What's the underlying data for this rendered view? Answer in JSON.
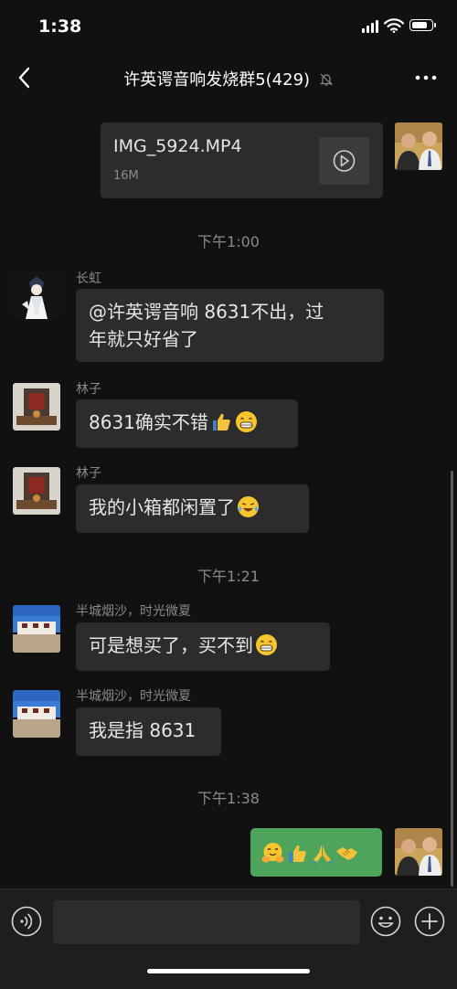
{
  "status_bar": {
    "time": "1:38"
  },
  "header": {
    "title": "许英谔音响发烧群5(429)",
    "muted": true
  },
  "file_message": {
    "name": "IMG_5924.MP4",
    "size": "16M"
  },
  "time_labels": [
    "下午1:00",
    "下午1:21",
    "下午1:38"
  ],
  "messages": [
    {
      "sender": "长虹",
      "lines": [
        "@许英谔音响 8631不出，过",
        "年就只好省了"
      ]
    },
    {
      "sender": "林子",
      "text": "8631确实不错",
      "emojis": [
        "thumbs-up",
        "grin"
      ]
    },
    {
      "sender": "林子",
      "text": "我的小箱都闲置了",
      "emojis": [
        "crying-laugh"
      ]
    },
    {
      "sender": "半城烟沙，时光微夏",
      "text": "可是想买了，买不到",
      "emojis": [
        "grin"
      ]
    },
    {
      "sender": "半城烟沙，时光微夏",
      "text": "我是指 8631"
    },
    {
      "sender": "",
      "text": "",
      "emojis": [
        "hugging-face",
        "thumbs-up",
        "folded-hands",
        "handshake"
      ]
    }
  ],
  "input": {
    "value": "",
    "placeholder": ""
  },
  "colors": {
    "background": "#111111",
    "incoming_bubble": "#2c2c2c",
    "outgoing_bubble": "#4fa45c",
    "meta_text": "#8a8a8a"
  }
}
